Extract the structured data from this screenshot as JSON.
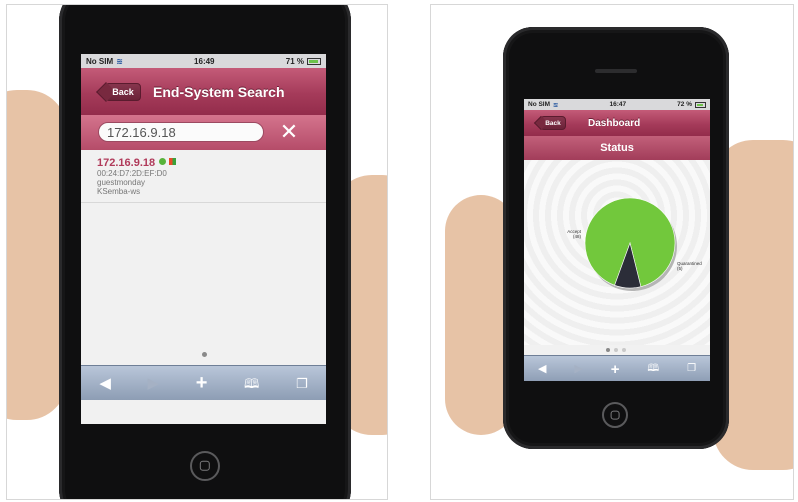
{
  "left_phone": {
    "status_bar": {
      "carrier": "No SIM",
      "time": "16:49",
      "battery": "71 %"
    },
    "nav": {
      "back_label": "Back",
      "title": "End-System Search"
    },
    "search": {
      "value": "172.16.9.18",
      "clear_icon": "close-icon"
    },
    "result": {
      "ip": "172.16.9.18",
      "mac": "00:24:D7:2D:EF:D0",
      "user": "guestmonday",
      "host": "KSemba-ws",
      "status_icon": "green-status-icon",
      "os_icon": "windows-flag-icon"
    },
    "toolbar": [
      "back-arrow-icon",
      "forward-arrow-icon",
      "plus-icon",
      "bookmarks-icon",
      "pages-icon"
    ]
  },
  "right_phone": {
    "status_bar": {
      "carrier": "No SIM",
      "time": "16:47",
      "battery": "72 %"
    },
    "nav": {
      "back_label": "Back",
      "title": "Dashboard"
    },
    "subheader": "Status",
    "colors": {
      "accept": "#72c83c",
      "quarantined": "#2b2d38"
    },
    "toolbar": [
      "back-arrow-icon",
      "forward-arrow-icon",
      "plus-icon",
      "bookmarks-icon",
      "pages-icon"
    ]
  },
  "chart_data": {
    "type": "pie",
    "title": "Status",
    "slices": [
      {
        "label": "Accept",
        "value": 48,
        "value_label": "(48)",
        "color": "#72c83c"
      },
      {
        "label": "Quarantined",
        "value": 5,
        "value_label": "(5)",
        "color": "#2b2d38"
      }
    ],
    "legend": "none"
  }
}
